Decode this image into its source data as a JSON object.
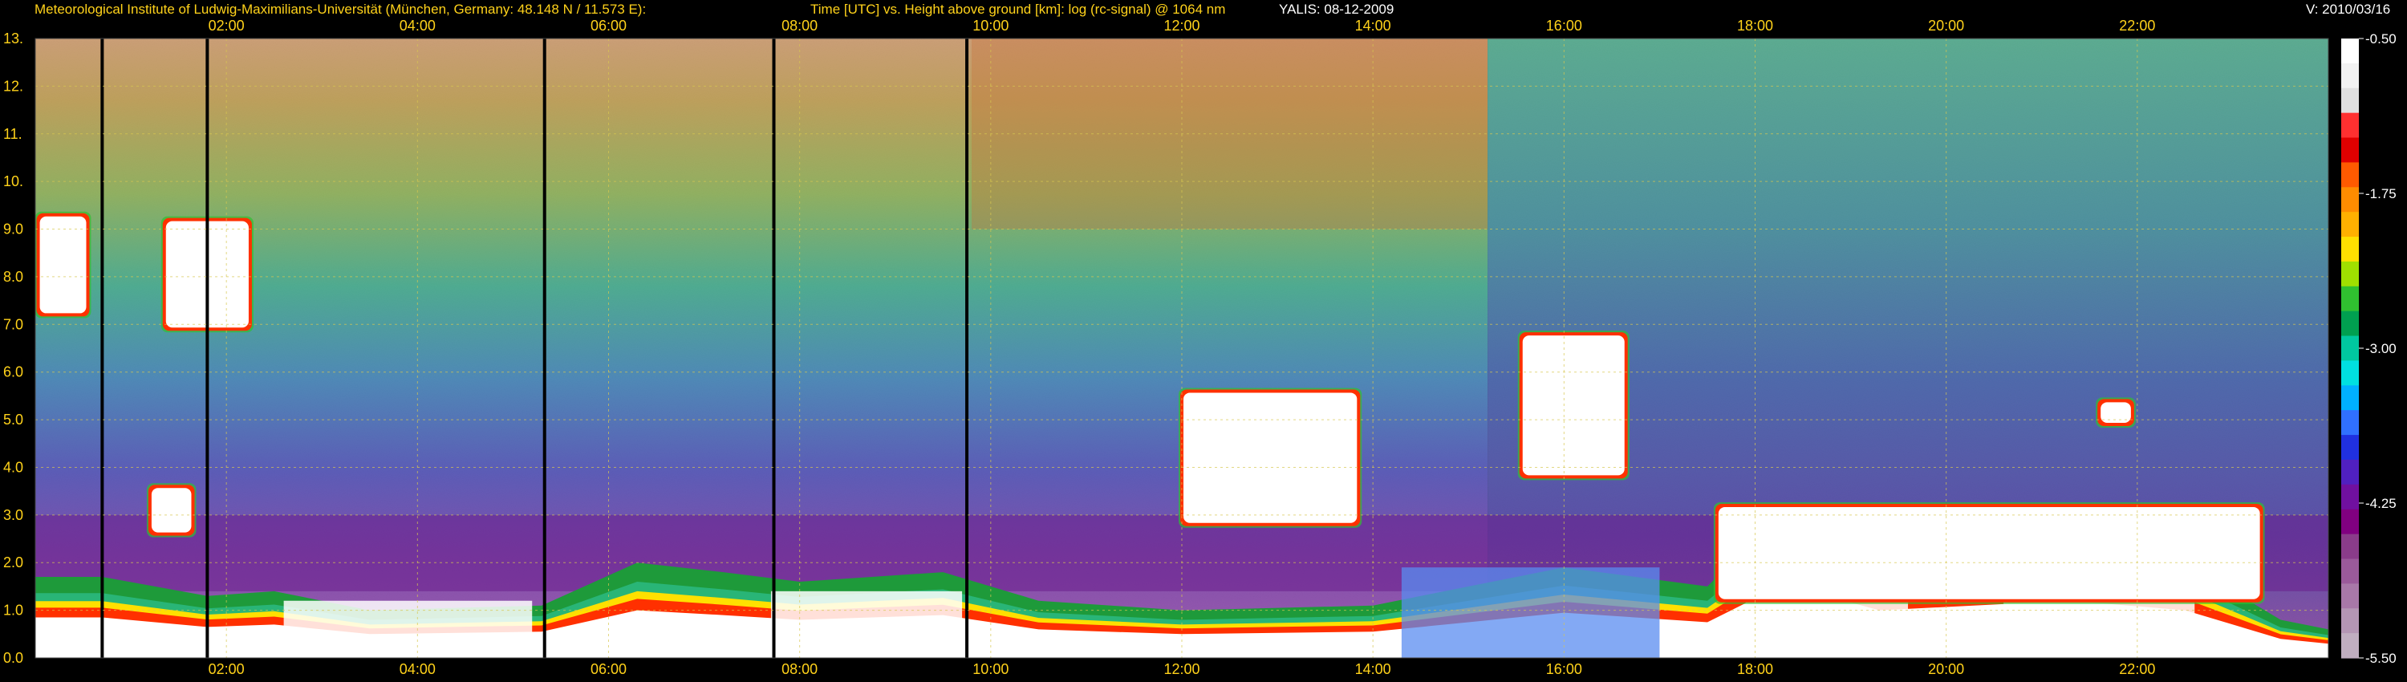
{
  "header": {
    "institute": "Meteorological Institute of Ludwig-Maximilians-Universität (München, Germany: 48.148 N / 11.573 E):",
    "plot_title": "Time [UTC] vs. Height above ground [km]: log (rc-signal) @ 1064 nm",
    "instrument_date": "YALIS: 08-12-2009",
    "version": "V: 2010/03/16"
  },
  "colors": {
    "background": "#000000",
    "title_text": "#ffd21a",
    "gridline": "#d8c850",
    "tick_text": "#ffd21a",
    "colorbar_text": "#ffffff"
  },
  "chart_data": {
    "type": "heatmap",
    "variable": "log (rc-signal) @ 1064 nm",
    "x_axis": {
      "range_hours": [
        0,
        24
      ],
      "ticks": [
        "02:00",
        "04:00",
        "06:00",
        "08:00",
        "10:00",
        "12:00",
        "14:00",
        "16:00",
        "18:00",
        "20:00",
        "22:00"
      ]
    },
    "y_axis": {
      "range_km": [
        0,
        13
      ],
      "ticks": [
        "0.0",
        "1.0",
        "2.0",
        "3.0",
        "4.0",
        "5.0",
        "6.0",
        "7.0",
        "8.0",
        "9.0",
        "10.",
        "11.",
        "12.",
        "13."
      ]
    },
    "grid": true,
    "colorbar": {
      "range": [
        -5.5,
        -0.5
      ],
      "tick_labels": [
        "-0.50",
        "-1.75",
        "-3.00",
        "-4.25",
        "-5.50"
      ],
      "tick_values": [
        -0.5,
        -1.75,
        -3.0,
        -4.25,
        -5.5
      ],
      "colors_top_to_bottom": [
        "#ffffff",
        "#f2f2f2",
        "#e0e0e0",
        "#ff3030",
        "#e00000",
        "#ff5a00",
        "#ff8c00",
        "#ffb000",
        "#ffe000",
        "#a0e000",
        "#30c030",
        "#00a050",
        "#00c8a0",
        "#00e0e0",
        "#00b0ff",
        "#3070ff",
        "#2030e0",
        "#5020c0",
        "#7010a0",
        "#800080",
        "#8a3c8a",
        "#9a5a9a",
        "#a878a8",
        "#b496b4",
        "#c0aec0"
      ]
    },
    "gaps_hours": [
      0.7,
      1.8,
      5.33,
      7.73,
      9.75
    ],
    "signal_ranges": {
      "near_ground_aerosol_km": [
        0,
        2
      ],
      "boundary_layer_top_km": [
        1.3,
        3.2
      ],
      "dark_blue_region_km": [
        2.0,
        6.5
      ]
    },
    "cloud_features": [
      {
        "time": [
          0.03,
          0.55
        ],
        "height_km": [
          7.2,
          9.3
        ],
        "class": "high"
      },
      {
        "time": [
          1.35,
          2.25
        ],
        "height_km": [
          6.9,
          9.2
        ],
        "class": "high"
      },
      {
        "time": [
          12.0,
          13.85
        ],
        "height_km": [
          2.8,
          5.6
        ],
        "class": "mid"
      },
      {
        "time": [
          15.55,
          16.65
        ],
        "height_km": [
          3.8,
          6.8
        ],
        "class": "mid"
      },
      {
        "time": [
          21.6,
          21.95
        ],
        "height_km": [
          4.9,
          5.4
        ],
        "class": "mid"
      },
      {
        "time": [
          1.2,
          1.65
        ],
        "height_km": [
          2.6,
          3.6
        ],
        "class": "low"
      },
      {
        "time": [
          17.6,
          23.3
        ],
        "height_km": [
          1.2,
          3.2
        ],
        "class": "boundary-layer"
      }
    ]
  }
}
